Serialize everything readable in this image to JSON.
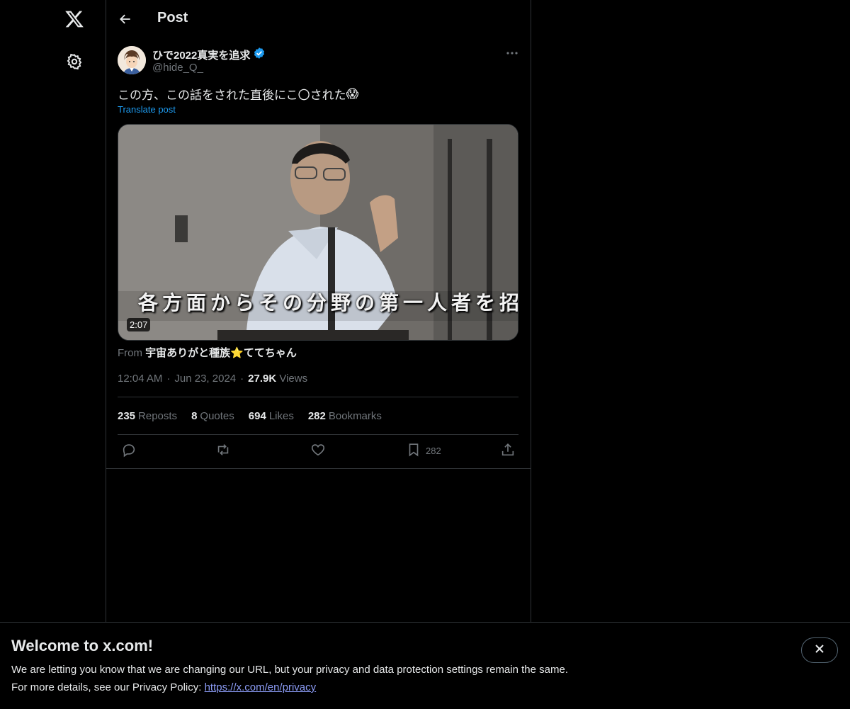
{
  "nav": {
    "logo_icon": "x-logo-icon",
    "settings_icon": "gear-icon"
  },
  "header": {
    "back_icon": "arrow-left-icon",
    "title": "Post"
  },
  "post": {
    "author_name": "ひで2022真実を追求",
    "verified": true,
    "handle": "@hide_Q_",
    "text": "この方、この話をされた直後にこ〇された",
    "emoji": "😱",
    "translate_label": "Translate post",
    "media": {
      "caption_overlay": "各方面からその分野の第一人者を招",
      "duration": "2:07"
    },
    "from_prefix": "From",
    "from_source": "宇宙ありがと種族⭐ててちゃん",
    "time": "12:04 AM",
    "date": "Jun 23, 2024",
    "views_count": "27.9K",
    "views_label": "Views",
    "stats": [
      {
        "count": "235",
        "label": "Reposts"
      },
      {
        "count": "8",
        "label": "Quotes"
      },
      {
        "count": "694",
        "label": "Likes"
      },
      {
        "count": "282",
        "label": "Bookmarks"
      }
    ],
    "actions": {
      "reply_icon": "reply-icon",
      "repost_icon": "repost-icon",
      "like_icon": "heart-icon",
      "bookmark_icon": "bookmark-icon",
      "bookmark_count": "282",
      "share_icon": "share-icon"
    }
  },
  "banner": {
    "heading": "Welcome to x.com!",
    "line1": "We are letting you know that we are changing our URL, but your privacy and data protection settings remain the same.",
    "line2_prefix": "For more details, see our Privacy Policy: ",
    "link": "https://x.com/en/privacy",
    "close_icon": "close-icon"
  },
  "colors": {
    "background": "#000000",
    "text": "#e7e9ea",
    "muted": "#71767b",
    "accent": "#1d9bf0",
    "border": "#2f3336"
  }
}
